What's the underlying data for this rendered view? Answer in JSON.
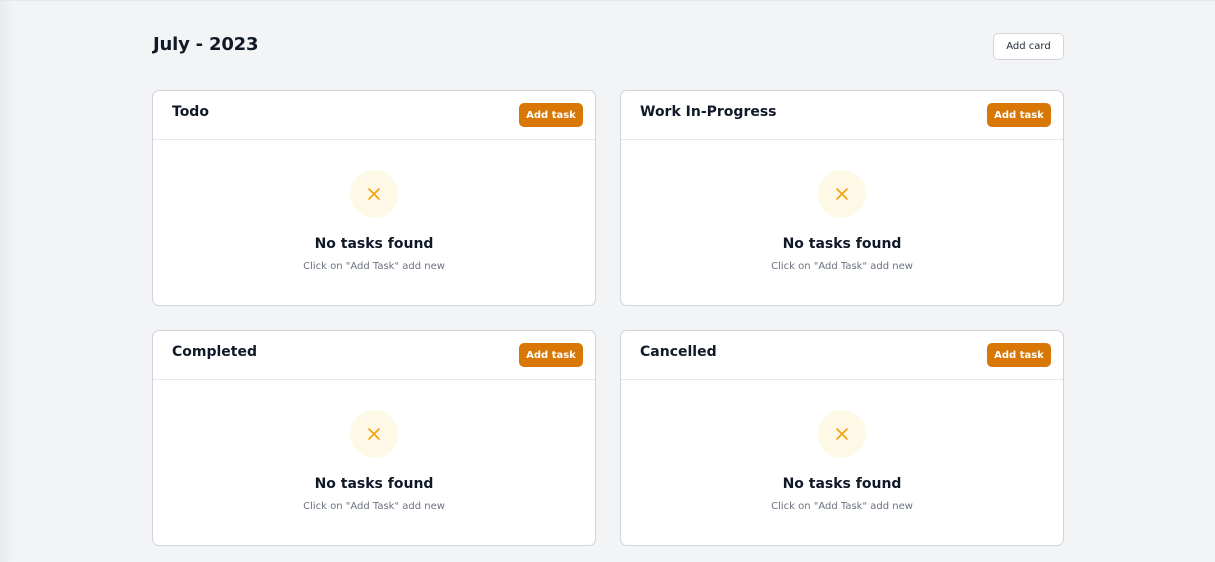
{
  "header": {
    "title": "July - 2023",
    "add_card_label": "Add card"
  },
  "columns": [
    {
      "title": "Todo",
      "add_task_label": "Add task",
      "empty_icon": "close-x-icon",
      "empty_title": "No tasks found",
      "empty_subtitle": "Click on \"Add Task\" add new"
    },
    {
      "title": "Work In-Progress",
      "add_task_label": "Add task",
      "empty_icon": "close-x-icon",
      "empty_title": "No tasks found",
      "empty_subtitle": "Click on \"Add Task\" add new"
    },
    {
      "title": "Completed",
      "add_task_label": "Add task",
      "empty_icon": "close-x-icon",
      "empty_title": "No tasks found",
      "empty_subtitle": "Click on \"Add Task\" add new"
    },
    {
      "title": "Cancelled",
      "add_task_label": "Add task",
      "empty_icon": "close-x-icon",
      "empty_title": "No tasks found",
      "empty_subtitle": "Click on \"Add Task\" add new"
    }
  ],
  "colors": {
    "accent": "#d97706",
    "empty_icon_bg": "#fef9e7",
    "empty_icon_stroke": "#f59e0b",
    "page_bg": "#f3f4f6"
  }
}
